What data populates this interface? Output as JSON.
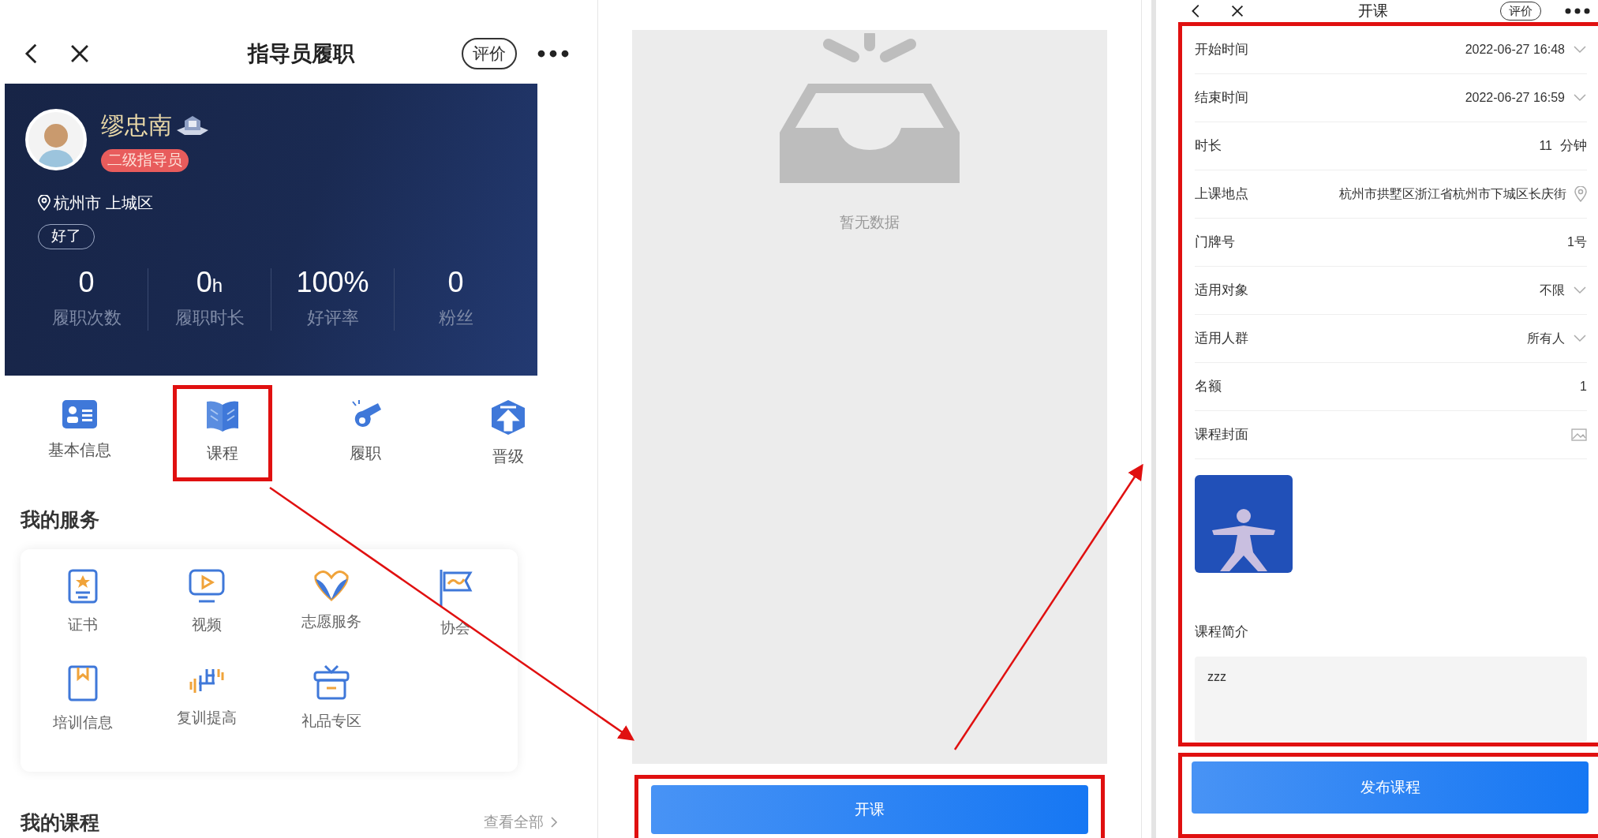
{
  "profile_screen": {
    "nav": {
      "title": "指导员履职",
      "rate_button": "评价"
    },
    "banner": {
      "name": "缪忠南",
      "badge": "二级指导员",
      "location": "杭州市 上城区",
      "status_button": "好了",
      "stats": [
        {
          "value": "0",
          "label": "履职次数"
        },
        {
          "value": "0",
          "unit": "h",
          "label": "履职时长"
        },
        {
          "value": "100%",
          "label": "好评率"
        },
        {
          "value": "0",
          "label": "粉丝"
        }
      ]
    },
    "quick_actions": [
      {
        "label": "基本信息",
        "kind": "id-card",
        "highlighted": false
      },
      {
        "label": "课程",
        "kind": "book",
        "highlighted": true
      },
      {
        "label": "履职",
        "kind": "whistle",
        "highlighted": false
      },
      {
        "label": "晋级",
        "kind": "upgrade",
        "highlighted": false
      }
    ],
    "services": {
      "title": "我的服务",
      "items": [
        {
          "label": "证书",
          "kind": "certificate"
        },
        {
          "label": "视频",
          "kind": "video"
        },
        {
          "label": "志愿服务",
          "kind": "heart"
        },
        {
          "label": "协会",
          "kind": "flag"
        },
        {
          "label": "培训信息",
          "kind": "bookmark"
        },
        {
          "label": "复训提高",
          "kind": "dumbbell"
        },
        {
          "label": "礼品专区",
          "kind": "gift"
        }
      ]
    },
    "my_courses": {
      "title": "我的课程",
      "link": "查看全部"
    }
  },
  "course_list_screen": {
    "empty_text": "暂无数据",
    "button": "开课",
    "highlighted": true
  },
  "new_course_screen": {
    "nav": {
      "title": "开课",
      "rate_button": "评价"
    },
    "highlighted": true,
    "fields": [
      {
        "label": "开始时间",
        "value": "2022-06-27 16:48",
        "kind": "select"
      },
      {
        "label": "结束时间",
        "value": "2022-06-27 16:59",
        "kind": "select"
      },
      {
        "label": "时长",
        "value": "11",
        "unit": "分钟",
        "kind": "unit"
      },
      {
        "label": "上课地点",
        "value": "杭州市拱墅区浙江省杭州市下城区长庆街",
        "kind": "location"
      },
      {
        "label": "门牌号",
        "value": "1号",
        "kind": "text"
      },
      {
        "label": "适用对象",
        "value": "不限",
        "kind": "select"
      },
      {
        "label": "适用人群",
        "value": "所有人",
        "kind": "select"
      },
      {
        "label": "名额",
        "value": "1",
        "kind": "text"
      },
      {
        "label": "课程封面",
        "kind": "image"
      }
    ],
    "intro": {
      "label": "课程简介",
      "value": "zzz"
    },
    "publish_button": "发布课程",
    "button_highlighted": true
  }
}
